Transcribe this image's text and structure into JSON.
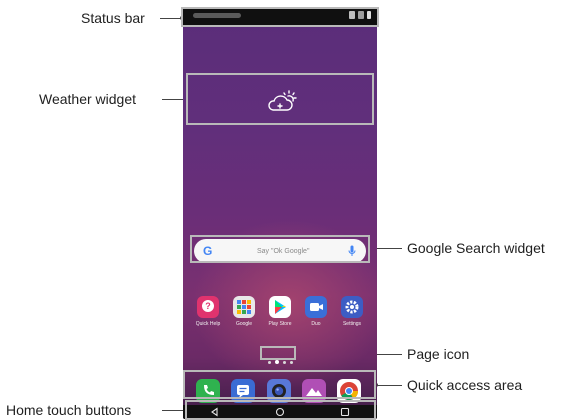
{
  "callouts": {
    "status_bar": "Status bar",
    "weather_widget": "Weather widget",
    "google_search_widget": "Google Search widget",
    "page_icon": "Page icon",
    "quick_access_area": "Quick access area",
    "home_touch_buttons": "Home touch buttons"
  },
  "search": {
    "hint": "Say \"Ok Google\"",
    "logo": "G"
  },
  "apps": [
    {
      "label": "Quick Help",
      "icon": "help-icon",
      "color": "#e0336e"
    },
    {
      "label": "Google",
      "icon": "folder-icon",
      "color": "#e8e8e8"
    },
    {
      "label": "Play Store",
      "icon": "play-store-icon",
      "color": "#ffffff"
    },
    {
      "label": "Duo",
      "icon": "duo-icon",
      "color": "#3a6fd8"
    },
    {
      "label": "Settings",
      "icon": "gear-icon",
      "color": "#3d5dc4"
    }
  ],
  "dock": [
    {
      "icon": "phone-icon",
      "color": "#2fb24f"
    },
    {
      "icon": "messages-icon",
      "color": "#3a6cd4"
    },
    {
      "icon": "camera-icon",
      "color": "#5878d8"
    },
    {
      "icon": "gallery-icon",
      "color": "#b04fb5"
    },
    {
      "icon": "chrome-icon",
      "color": "#ffffff"
    }
  ]
}
